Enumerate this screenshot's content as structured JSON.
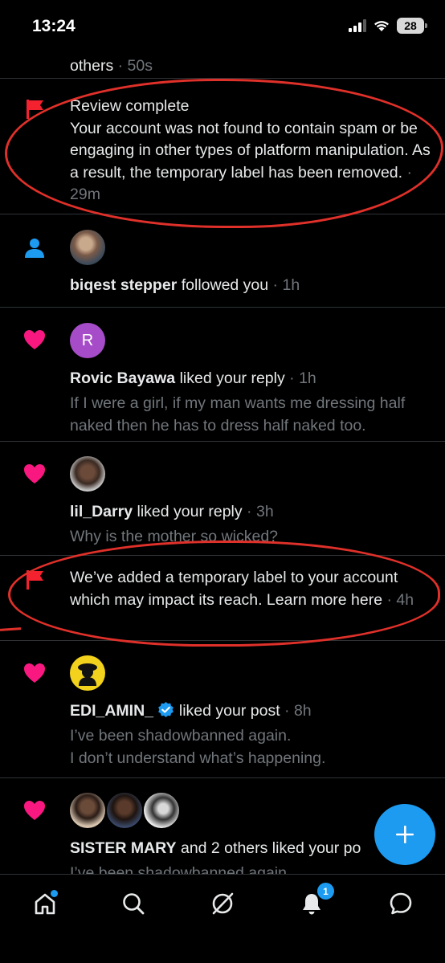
{
  "status_bar": {
    "time": "13:24",
    "battery": "28"
  },
  "notifications": [
    {
      "type": "partial",
      "text": "others",
      "time": "50s"
    },
    {
      "type": "flag",
      "title": "Review complete",
      "body": "Your account was not found to contain spam or be engaging in other types of platform manipulation. As a result, the temporary label has been removed.",
      "time": "29m"
    },
    {
      "type": "follow",
      "name": "biqest stepper",
      "action": "followed you",
      "time": "1h"
    },
    {
      "type": "like",
      "name": "Rovic Bayawa",
      "action": "liked your reply",
      "time": "1h",
      "avatar_letter": "R",
      "preview": "If I were a girl, if my man wants me dressing half naked then he has to dress half naked too."
    },
    {
      "type": "like",
      "name": "lil_Darry",
      "action": "liked your reply",
      "time": "3h",
      "preview": "Why is the mother so wicked?"
    },
    {
      "type": "flag",
      "body": "We’ve added a temporary label to your account which may impact its reach. Learn more here",
      "time": "4h"
    },
    {
      "type": "like",
      "name": "EDI_AMIN_",
      "verified": true,
      "action": "liked your post",
      "time": "8h",
      "preview_line1": "I’ve been shadowbanned again.",
      "preview_line2": "I don’t understand what’s happening."
    },
    {
      "type": "like",
      "name": "SISTER MARY",
      "action": "and 2 others liked your po",
      "preview": "I’ve been shadowbanned again."
    }
  ],
  "tabbar": {
    "notification_count": "1"
  },
  "colors": {
    "like": "#f91880",
    "flag": "#f4212e",
    "follow": "#1d9bf0",
    "accent": "#1d9bf0",
    "annotation": "#e0302a"
  },
  "icons": [
    "signal-icon",
    "wifi-icon",
    "flag-icon",
    "person-icon",
    "heart-icon",
    "verified-icon",
    "compose-plus-icon",
    "home-icon",
    "search-icon",
    "grok-icon",
    "bell-icon",
    "messages-icon"
  ]
}
